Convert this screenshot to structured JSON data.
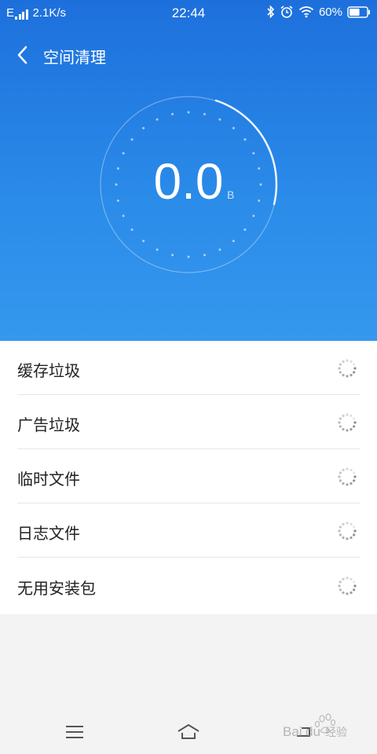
{
  "status_bar": {
    "network_type": "E",
    "speed": "2.1K/s",
    "time": "22:44",
    "battery": "60%",
    "battery_level": 0.6,
    "icons": [
      "signal-icon",
      "bluetooth-icon",
      "alarm-icon",
      "wifi-icon",
      "battery-icon"
    ]
  },
  "header": {
    "title": "空间清理",
    "back_icon": "back-arrow-icon"
  },
  "gauge": {
    "value": "0.0",
    "unit": "B"
  },
  "items": [
    {
      "label": "缓存垃圾",
      "status_icon": "loading-spinner-icon"
    },
    {
      "label": "广告垃圾",
      "status_icon": "loading-spinner-icon"
    },
    {
      "label": "临时文件",
      "status_icon": "loading-spinner-icon"
    },
    {
      "label": "日志文件",
      "status_icon": "loading-spinner-icon"
    },
    {
      "label": "无用安装包",
      "status_icon": "loading-spinner-icon"
    }
  ],
  "navbar": {
    "icons": [
      "menu-icon",
      "home-icon",
      "back-icon"
    ]
  },
  "watermark": {
    "text": "Baidu经验"
  },
  "colors": {
    "header_top": "#1d70dc",
    "header_bottom": "#3598ee",
    "list_bg": "#ffffff",
    "page_bg": "#f3f3f3"
  }
}
